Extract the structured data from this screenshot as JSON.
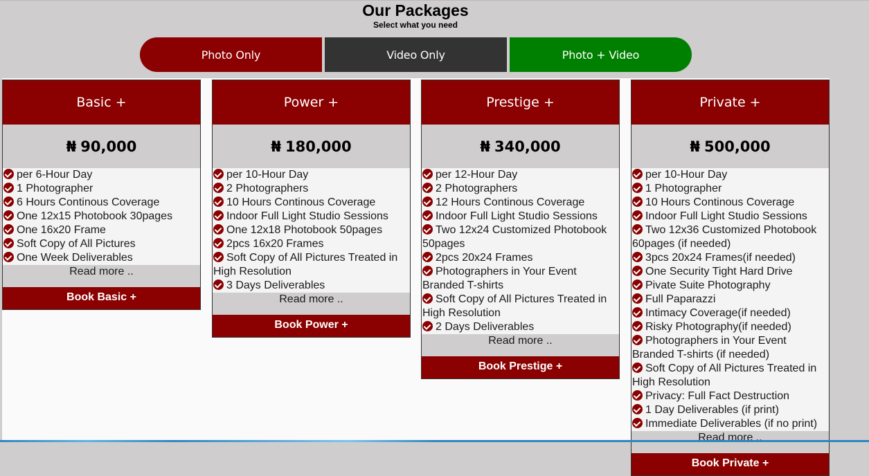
{
  "header": {
    "title": "Our Packages",
    "subtitle": "Select what you need"
  },
  "tabs": [
    {
      "label": "Photo Only",
      "color": "#8b0000"
    },
    {
      "label": "Video Only",
      "color": "#333333"
    },
    {
      "label": "Photo + Video",
      "color": "#008000"
    }
  ],
  "colors": {
    "accent": "#8b0000",
    "page_bg": "#cfcdce",
    "content_bg": "#fafafa"
  },
  "packages": [
    {
      "name": "Basic +",
      "currency": "₦",
      "price": "90,000",
      "features": [
        "per 6-Hour Day",
        "1 Photographer",
        "6 Hours Continous Coverage",
        "One 12x15 Photobook 30pages",
        "One 16x20 Frame",
        "Soft Copy of All Pictures",
        "One Week Deliverables"
      ],
      "read_more": "Read more ..",
      "book_label": "Book Basic +"
    },
    {
      "name": "Power +",
      "currency": "₦",
      "price": "180,000",
      "features": [
        "per 10-Hour Day",
        "2 Photographers",
        "10 Hours Continous Coverage",
        "Indoor Full Light Studio Sessions",
        "One 12x18 Photobook 50pages",
        "2pcs 16x20 Frames",
        "Soft Copy of All Pictures Treated in High Resolution",
        "3 Days Deliverables"
      ],
      "read_more": "Read more ..",
      "book_label": "Book Power +"
    },
    {
      "name": "Prestige +",
      "currency": "₦",
      "price": "340,000",
      "features": [
        "per 12-Hour Day",
        "2 Photographers",
        "12 Hours Continous Coverage",
        "Indoor Full Light Studio Sessions",
        "Two 12x24 Customized Photobook 50pages",
        "2pcs 20x24 Frames",
        "Photographers in Your Event Branded T-shirts",
        "Soft Copy of All Pictures Treated in High Resolution",
        "2 Days Deliverables"
      ],
      "read_more": "Read more ..",
      "book_label": "Book Prestige +"
    },
    {
      "name": "Private +",
      "currency": "₦",
      "price": "500,000",
      "features": [
        "per 10-Hour Day",
        "1 Photographer",
        "10 Hours Continous Coverage",
        "Indoor Full Light Studio Sessions",
        "Two 12x36 Customized Photobook 60pages (if needed)",
        "3pcs 20x24 Frames(if needed)",
        "One Security Tight Hard Drive",
        "Pivate Suite Photography",
        "Full Paparazzi",
        "Intimacy Coverage(if needed)",
        "Risky Photography(if needed)",
        "Photographers in Your Event Branded T-shirts (if needed)",
        "Soft Copy of All Pictures Treated in High Resolution",
        "Privacy: Full Fact Destruction",
        "1 Day Deliverables (if print)",
        "Immediate Deliverables (if no print)"
      ],
      "read_more": "Read more ..",
      "book_label": "Book Private +"
    }
  ]
}
